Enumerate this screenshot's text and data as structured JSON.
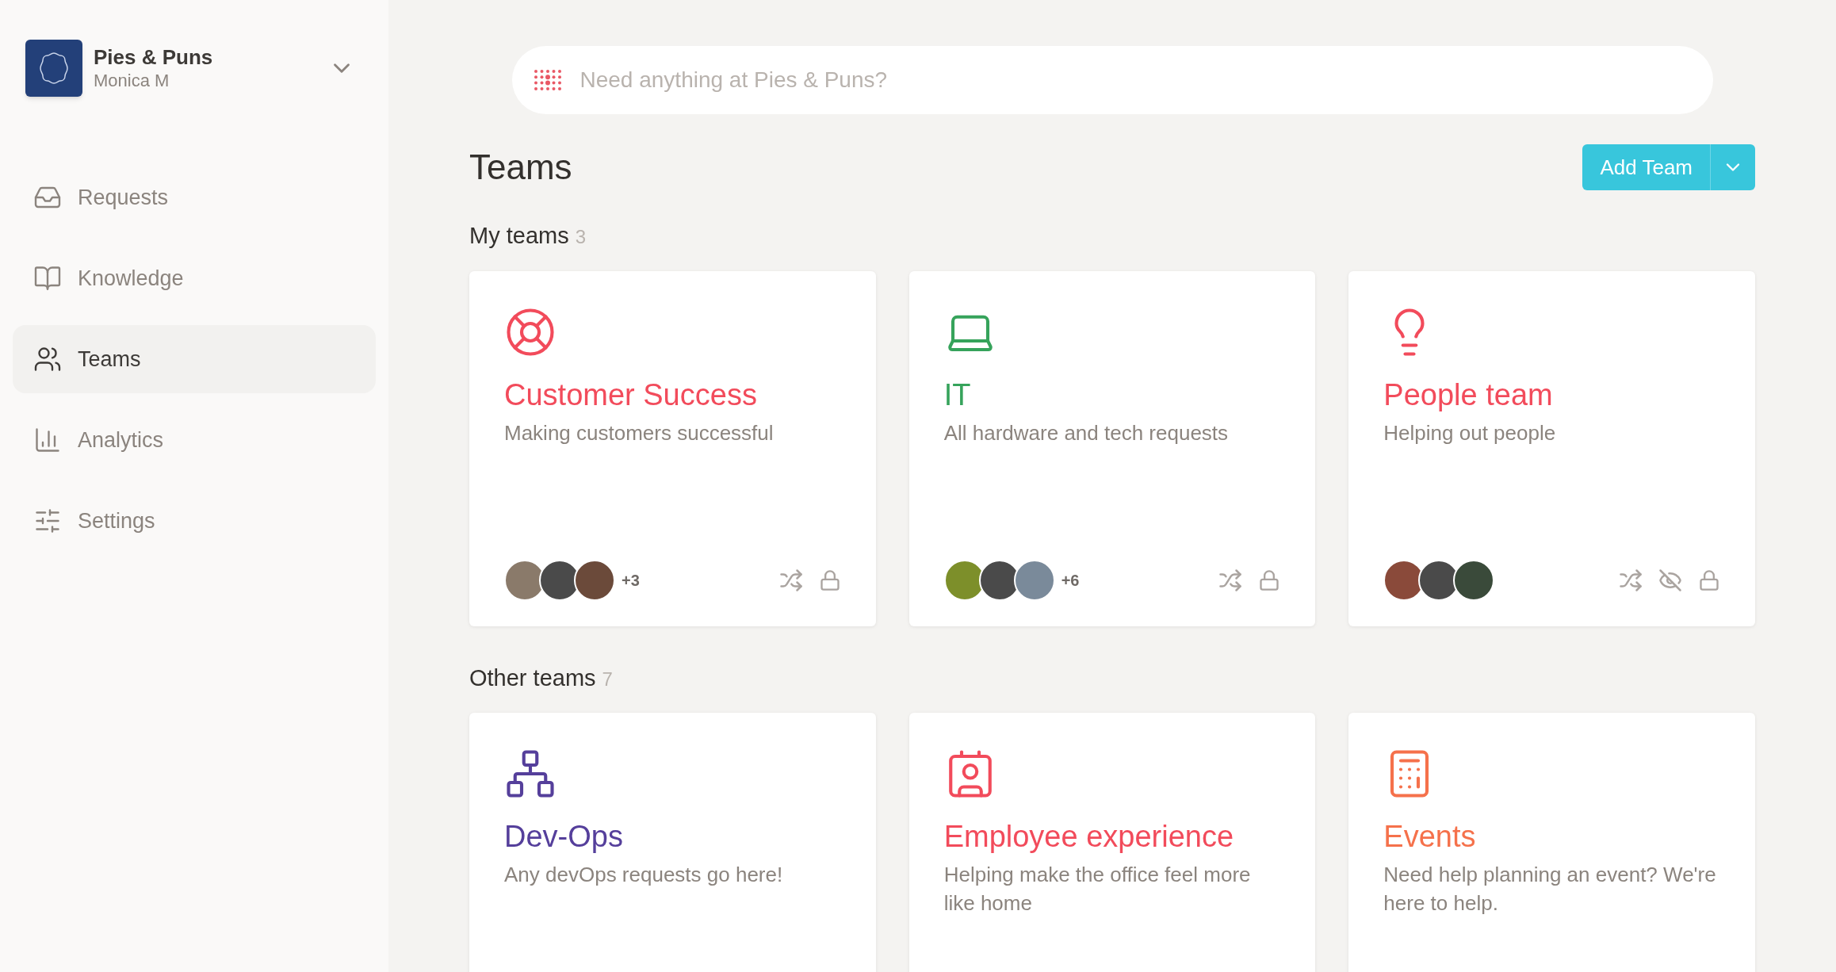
{
  "workspace": {
    "name": "Pies & Puns",
    "user": "Monica M"
  },
  "sidebar": {
    "items": [
      {
        "label": "Requests",
        "selected": false
      },
      {
        "label": "Knowledge",
        "selected": false
      },
      {
        "label": "Teams",
        "selected": true
      },
      {
        "label": "Analytics",
        "selected": false
      },
      {
        "label": "Settings",
        "selected": false
      }
    ]
  },
  "search": {
    "placeholder": "Need anything at Pies & Puns?"
  },
  "page": {
    "title": "Teams",
    "add_button": "Add Team"
  },
  "sections": [
    {
      "title": "My teams",
      "count": "3",
      "teams": [
        {
          "name": "Customer Success",
          "description": "Making customers successful",
          "color": "#f24b5b",
          "extra_members": "+3",
          "hidden": false
        },
        {
          "name": "IT",
          "description": "All hardware and tech requests",
          "color": "#36a35b",
          "extra_members": "+6",
          "hidden": false
        },
        {
          "name": "People team",
          "description": "Helping out people",
          "color": "#f24b5b",
          "hidden": true
        }
      ]
    },
    {
      "title": "Other teams",
      "count": "7",
      "teams": [
        {
          "name": "Dev-Ops",
          "description": "Any devOps requests go here!",
          "color": "#553f9b"
        },
        {
          "name": "Employee experience",
          "description": "Helping make the office feel more like home",
          "color": "#f24b5b"
        },
        {
          "name": "Events",
          "description": "Need help planning an event? We're here to help.",
          "color": "#f5714b"
        }
      ]
    }
  ]
}
